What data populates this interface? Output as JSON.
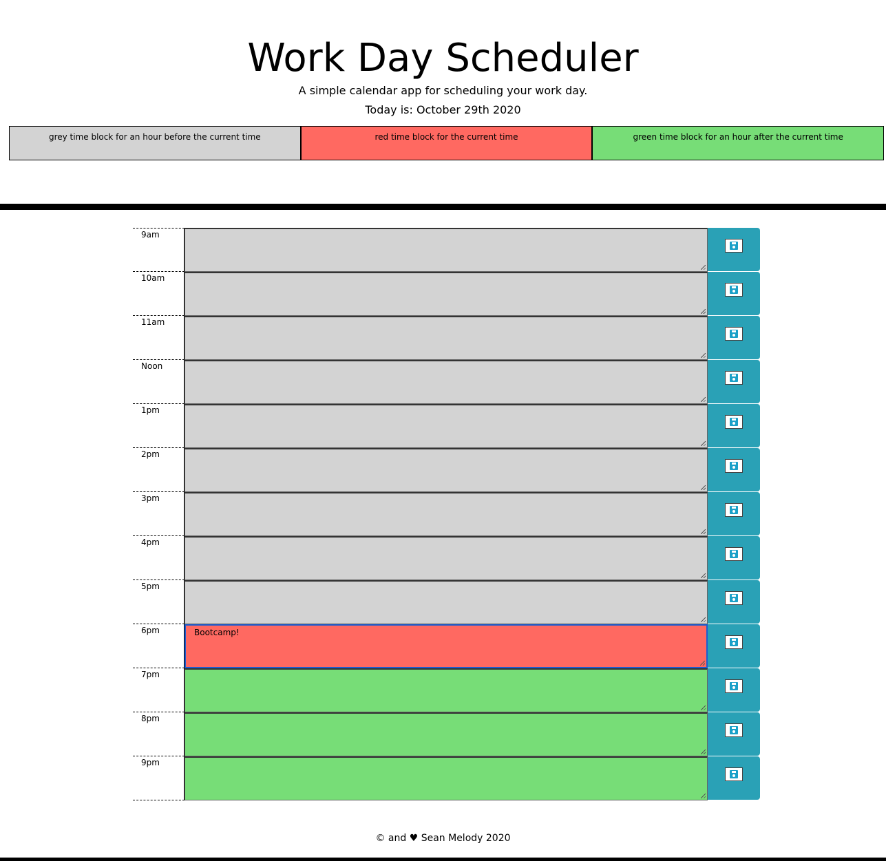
{
  "header": {
    "title": "Work Day Scheduler",
    "subtitle": "A simple calendar app for scheduling your work day.",
    "today": "Today is: October 29th 2020"
  },
  "legend": {
    "past": "grey time block for an hour before the current time",
    "present": "red time block for the current time",
    "future": "green time block for an hour after the current time"
  },
  "colors": {
    "past": "#d3d3d3",
    "present": "#ff6961",
    "future": "#77dd77",
    "save_button": "#2aa1b6"
  },
  "rows": [
    {
      "hour": "9am",
      "text": "",
      "state": "past"
    },
    {
      "hour": "10am",
      "text": "",
      "state": "past"
    },
    {
      "hour": "11am",
      "text": "",
      "state": "past"
    },
    {
      "hour": "Noon",
      "text": "",
      "state": "past"
    },
    {
      "hour": "1pm",
      "text": "",
      "state": "past"
    },
    {
      "hour": "2pm",
      "text": "",
      "state": "past"
    },
    {
      "hour": "3pm",
      "text": "",
      "state": "past"
    },
    {
      "hour": "4pm",
      "text": "",
      "state": "past"
    },
    {
      "hour": "5pm",
      "text": "",
      "state": "past"
    },
    {
      "hour": "6pm",
      "text": "Bootcamp!",
      "state": "present"
    },
    {
      "hour": "7pm",
      "text": "",
      "state": "future"
    },
    {
      "hour": "8pm",
      "text": "",
      "state": "future"
    },
    {
      "hour": "9pm",
      "text": "",
      "state": "future"
    }
  ],
  "save_icon": "save-icon",
  "footer": "© and ♥ Sean Melody 2020"
}
